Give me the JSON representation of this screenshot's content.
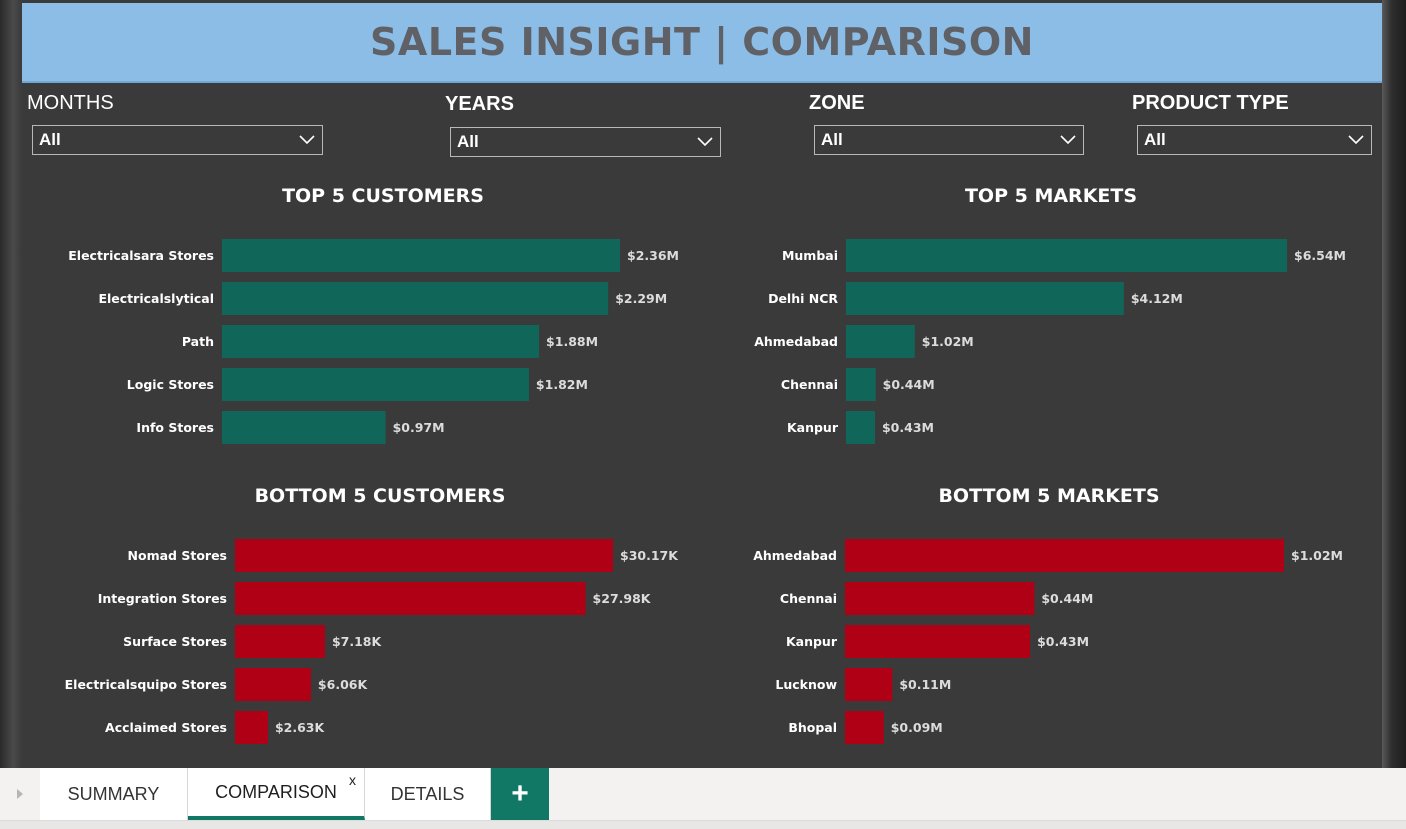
{
  "header": {
    "title": "SALES INSIGHT | COMPARISON"
  },
  "filters": [
    {
      "label": "MONTHS",
      "value": "All"
    },
    {
      "label": "YEARS",
      "value": "All"
    },
    {
      "label": "ZONE",
      "value": "All"
    },
    {
      "label": "PRODUCT TYPE",
      "value": "All"
    }
  ],
  "colors": {
    "top_bar": "#11665a",
    "bottom_bar": "#b00016",
    "header_bg": "#8bbde6",
    "canvas_bg": "#3a3a3a",
    "active_tab": "#117865"
  },
  "chart_data": [
    {
      "type": "bar",
      "orientation": "horizontal",
      "title": "TOP 5 CUSTOMERS",
      "categories": [
        "Electricalsara Stores",
        "Electricalslytical",
        "Path",
        "Logic Stores",
        "Info Stores"
      ],
      "values": [
        2.36,
        2.29,
        1.88,
        1.82,
        0.97
      ],
      "value_labels": [
        "$2.36M",
        "$2.29M",
        "$1.88M",
        "$1.82M",
        "$0.97M"
      ],
      "unit": "M",
      "color": "#11665a"
    },
    {
      "type": "bar",
      "orientation": "horizontal",
      "title": "TOP 5 MARKETS",
      "categories": [
        "Mumbai",
        "Delhi NCR",
        "Ahmedabad",
        "Chennai",
        "Kanpur"
      ],
      "values": [
        6.54,
        4.12,
        1.02,
        0.44,
        0.43
      ],
      "value_labels": [
        "$6.54M",
        "$4.12M",
        "$1.02M",
        "$0.44M",
        "$0.43M"
      ],
      "unit": "M",
      "color": "#11665a"
    },
    {
      "type": "bar",
      "orientation": "horizontal",
      "title": "BOTTOM 5 CUSTOMERS",
      "categories": [
        "Nomad Stores",
        "Integration Stores",
        "Surface Stores",
        "Electricalsquipo Stores",
        "Acclaimed Stores"
      ],
      "values": [
        30.17,
        27.98,
        7.18,
        6.06,
        2.63
      ],
      "value_labels": [
        "$30.17K",
        "$27.98K",
        "$7.18K",
        "$6.06K",
        "$2.63K"
      ],
      "unit": "K",
      "color": "#b00016"
    },
    {
      "type": "bar",
      "orientation": "horizontal",
      "title": "BOTTOM 5 MARKETS",
      "categories": [
        "Ahmedabad",
        "Chennai",
        "Kanpur",
        "Lucknow",
        "Bhopal"
      ],
      "values": [
        1.02,
        0.44,
        0.43,
        0.11,
        0.09
      ],
      "value_labels": [
        "$1.02M",
        "$0.44M",
        "$0.43M",
        "$0.11M",
        "$0.09M"
      ],
      "unit": "M",
      "color": "#b00016"
    }
  ],
  "tabs": [
    {
      "label": "SUMMARY",
      "active": false
    },
    {
      "label": "COMPARISON",
      "active": true
    },
    {
      "label": "DETAILS",
      "active": false
    }
  ],
  "tab_close_label": "x",
  "add_tab_label": "+"
}
